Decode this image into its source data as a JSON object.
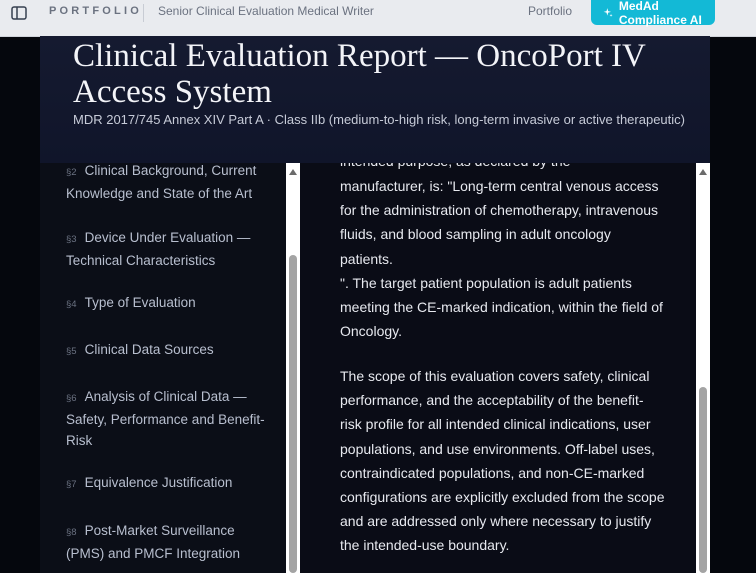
{
  "topbar": {
    "brand": "PORTFOLIO",
    "subtitle": "Senior Clinical Evaluation Medical Writer",
    "nav_portfolio": "Portfolio",
    "cta_label": "MedAd Compliance AI",
    "cta_color": "#13b9d6"
  },
  "hero": {
    "title": "Clinical Evaluation Report — OncoPort IV Access System",
    "meta": "MDR 2017/745 Annex XIV Part A · Class IIb (medium-to-high risk, long-term invasive or active therapeutic)"
  },
  "toc": {
    "items": [
      {
        "num": "§2",
        "label": "Clinical Background, Current Knowledge and State of the Art"
      },
      {
        "num": "§3",
        "label": "Device Under Evaluation — Technical Characteristics"
      },
      {
        "num": "§4",
        "label": "Type of Evaluation"
      },
      {
        "num": "§5",
        "label": "Clinical Data Sources"
      },
      {
        "num": "§6",
        "label": "Analysis of Clinical Data — Safety, Performance and Benefit-Risk"
      },
      {
        "num": "§7",
        "label": "Equivalence Justification"
      },
      {
        "num": "§8",
        "label": "Post-Market Surveillance (PMS) and PMCF Integration"
      }
    ]
  },
  "content": {
    "para_cut": "intended purpose, as declared by the",
    "para1": "manufacturer, is: \"Long-term central venous access for the administration of chemotherapy, intravenous fluids, and blood sampling in adult oncology patients.",
    "para1b": "\". The target patient population is adult patients meeting the CE-marked indication, within the field of Oncology.",
    "para2": "The scope of this evaluation covers safety, clinical performance, and the acceptability of the benefit-risk profile for all intended clinical indications, user populations, and use environments. Off-label uses, contraindicated populations, and non-CE-marked configurations are explicitly excluded from the scope and are addressed only where necessary to justify the intended-use boundary."
  }
}
